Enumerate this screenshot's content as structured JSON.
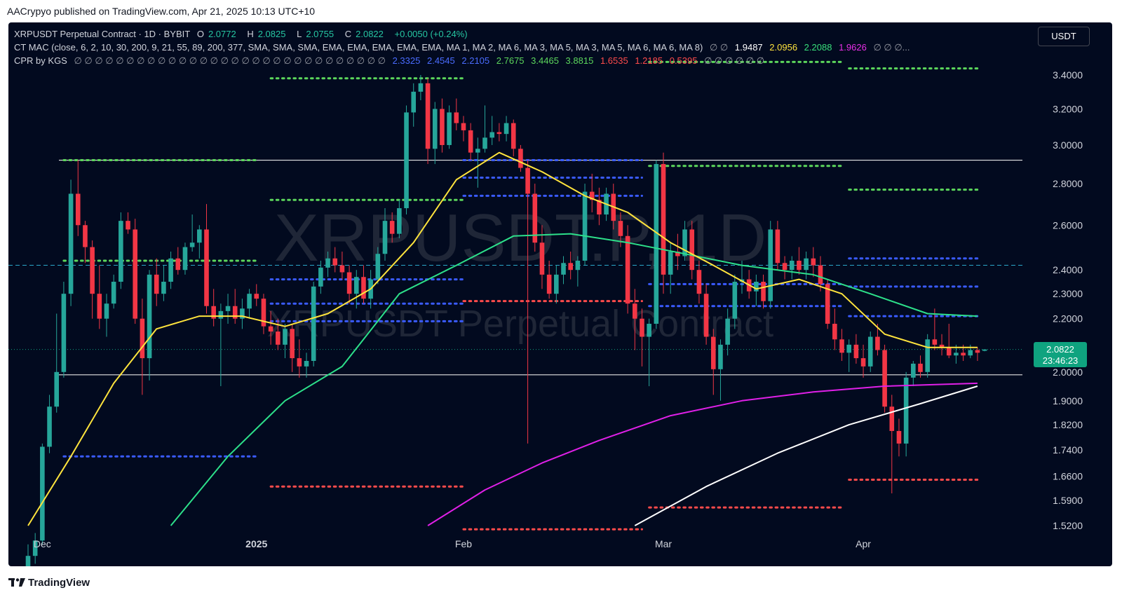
{
  "header": {
    "published": "AACrypyo published on TradingView.com, Apr 21, 2025 10:13 UTC+10"
  },
  "legend1": {
    "symbol": "XRPUSDT Perpetual Contract · 1D · BYBIT",
    "o_label": "O",
    "o": "2.0772",
    "h_label": "H",
    "h": "2.0825",
    "l_label": "L",
    "l": "2.0755",
    "c_label": "C",
    "c": "2.0822",
    "change": "+0.0050 (+0.24%)"
  },
  "legend2": {
    "text": "CT MAC (close, 6, 2, 10, 30, 200, 9, 21, 55, 89, 200, 377, SMA, SMA, SMA, EMA, EMA, EMA, EMA, EMA, MA 1, MA 2, MA 6, MA 3, MA 5, MA 3, MA 5, MA 6, MA 6, MA 8)",
    "placeholders_a": "∅ ∅",
    "v1": "1.9487",
    "v2": "2.0956",
    "v3": "2.2088",
    "v4": "1.9626",
    "placeholders_b": "∅ ∅ ∅..."
  },
  "legend3": {
    "name": "CPR by KGS",
    "placeholders_a": "∅ ∅ ∅ ∅ ∅ ∅ ∅ ∅ ∅ ∅ ∅ ∅ ∅ ∅ ∅ ∅ ∅ ∅ ∅ ∅ ∅ ∅ ∅ ∅ ∅ ∅ ∅ ∅ ∅ ∅",
    "v1": "2.3325",
    "v2": "2.4545",
    "v3": "2.2105",
    "v4": "2.7675",
    "v5": "3.4465",
    "v6": "3.8815",
    "v7": "1.6535",
    "v8": "1.2185",
    "v9": "0.5395",
    "placeholders_b": "∅ ∅ ∅ ∅ ∅ ∅"
  },
  "currency_button": "USDT",
  "price_badge": {
    "price": "2.0822",
    "countdown": "23:46:23"
  },
  "watermark": {
    "line1": "XRPUSDT.P, 1D",
    "line2": "XRPUSDT Perpetual Contract"
  },
  "brand": {
    "name": "TradingView"
  },
  "colors": {
    "up": "#26a69a",
    "down": "#f23645",
    "ema_yellow": "#ffe43d",
    "ema_green": "#2de08a",
    "ma_magenta": "#e020e8",
    "ma_white": "#ffffff",
    "cpr_blue": "#3a5bff",
    "cpr_green": "#5cd65c",
    "cpr_red": "#ff4b4b",
    "background": "#020a1f"
  },
  "chart_data": {
    "type": "candlestick",
    "timeframe": "1D",
    "y_scale": "log",
    "y_ticks": [
      "3.4000",
      "3.2000",
      "3.0000",
      "2.8000",
      "2.6000",
      "2.4000",
      "2.3000",
      "2.2000",
      "2.0000",
      "1.9000",
      "1.8200",
      "1.7400",
      "1.6600",
      "1.5900",
      "1.5200"
    ],
    "x_ticks": [
      "Dec",
      "2025",
      "Feb",
      "Mar",
      "Apr"
    ],
    "last_price": 2.0822,
    "horizontal_lines": [
      2.92,
      1.99
    ],
    "dashed_line": 2.42,
    "candles": [
      [
        1.4,
        1.47,
        1.38,
        1.44
      ],
      [
        1.44,
        1.5,
        1.42,
        1.48
      ],
      [
        1.48,
        1.76,
        1.47,
        1.75
      ],
      [
        1.75,
        1.92,
        1.73,
        1.88
      ],
      [
        1.88,
        2.22,
        1.86,
        2.0
      ],
      [
        2.0,
        2.35,
        1.98,
        2.3
      ],
      [
        2.3,
        2.82,
        2.25,
        2.75
      ],
      [
        2.75,
        2.92,
        2.55,
        2.6
      ],
      [
        2.6,
        2.62,
        2.43,
        2.5
      ],
      [
        2.5,
        2.53,
        2.2,
        2.3
      ],
      [
        2.3,
        2.42,
        2.16,
        2.2
      ],
      [
        2.2,
        2.3,
        2.13,
        2.26
      ],
      [
        2.26,
        2.38,
        2.24,
        2.35
      ],
      [
        2.35,
        2.66,
        2.32,
        2.62
      ],
      [
        2.62,
        2.66,
        2.56,
        2.58
      ],
      [
        2.58,
        2.63,
        2.18,
        2.2
      ],
      [
        2.2,
        2.28,
        1.92,
        2.05
      ],
      [
        2.05,
        2.4,
        1.97,
        2.38
      ],
      [
        2.38,
        2.45,
        2.25,
        2.3
      ],
      [
        2.3,
        2.42,
        2.27,
        2.35
      ],
      [
        2.35,
        2.48,
        2.32,
        2.45
      ],
      [
        2.45,
        2.5,
        2.38,
        2.4
      ],
      [
        2.4,
        2.52,
        2.38,
        2.5
      ],
      [
        2.5,
        2.65,
        2.48,
        2.52
      ],
      [
        2.52,
        2.6,
        2.45,
        2.58
      ],
      [
        2.58,
        2.7,
        2.22,
        2.25
      ],
      [
        2.25,
        2.32,
        2.17,
        2.2
      ],
      [
        2.2,
        2.26,
        1.95,
        2.23
      ],
      [
        2.23,
        2.3,
        2.18,
        2.25
      ],
      [
        2.25,
        2.32,
        2.18,
        2.2
      ],
      [
        2.2,
        2.28,
        2.16,
        2.24
      ],
      [
        2.24,
        2.32,
        2.2,
        2.3
      ],
      [
        2.3,
        2.34,
        2.25,
        2.28
      ],
      [
        2.28,
        2.3,
        2.14,
        2.17
      ],
      [
        2.17,
        2.23,
        2.1,
        2.15
      ],
      [
        2.15,
        2.2,
        2.08,
        2.1
      ],
      [
        2.1,
        2.18,
        2.05,
        2.16
      ],
      [
        2.16,
        2.18,
        2.0,
        2.05
      ],
      [
        2.05,
        2.12,
        1.98,
        2.02
      ],
      [
        2.02,
        2.07,
        1.98,
        2.04
      ],
      [
        2.04,
        2.35,
        2.02,
        2.33
      ],
      [
        2.33,
        2.44,
        2.3,
        2.41
      ],
      [
        2.41,
        2.48,
        2.37,
        2.45
      ],
      [
        2.45,
        2.5,
        2.39,
        2.42
      ],
      [
        2.42,
        2.48,
        2.36,
        2.39
      ],
      [
        2.39,
        2.42,
        2.26,
        2.3
      ],
      [
        2.3,
        2.4,
        2.24,
        2.37
      ],
      [
        2.37,
        2.42,
        2.26,
        2.28
      ],
      [
        2.28,
        2.4,
        2.24,
        2.36
      ],
      [
        2.36,
        2.5,
        2.34,
        2.47
      ],
      [
        2.47,
        2.68,
        2.44,
        2.62
      ],
      [
        2.62,
        2.66,
        2.52,
        2.56
      ],
      [
        2.56,
        2.72,
        2.54,
        2.68
      ],
      [
        2.68,
        3.22,
        2.65,
        3.18
      ],
      [
        3.18,
        3.35,
        3.1,
        3.3
      ],
      [
        3.3,
        3.4,
        3.25,
        3.35
      ],
      [
        3.35,
        3.38,
        2.9,
        2.98
      ],
      [
        2.98,
        3.24,
        2.9,
        3.2
      ],
      [
        3.2,
        3.26,
        2.96,
        3.0
      ],
      [
        3.0,
        3.22,
        2.98,
        3.18
      ],
      [
        3.18,
        3.26,
        3.08,
        3.12
      ],
      [
        3.12,
        3.16,
        3.02,
        3.08
      ],
      [
        3.08,
        3.12,
        2.92,
        2.96
      ],
      [
        2.96,
        3.04,
        2.78,
        2.98
      ],
      [
        2.98,
        3.22,
        2.96,
        3.04
      ],
      [
        3.04,
        3.16,
        3.0,
        3.07
      ],
      [
        3.07,
        3.12,
        3.02,
        3.06
      ],
      [
        3.06,
        3.16,
        3.02,
        3.12
      ],
      [
        3.12,
        3.14,
        2.94,
        2.98
      ],
      [
        2.98,
        3.0,
        2.86,
        2.88
      ],
      [
        2.88,
        2.92,
        1.76,
        2.75
      ],
      [
        2.75,
        2.8,
        2.48,
        2.52
      ],
      [
        2.52,
        2.6,
        2.32,
        2.38
      ],
      [
        2.38,
        2.44,
        2.28,
        2.3
      ],
      [
        2.3,
        2.42,
        2.26,
        2.38
      ],
      [
        2.38,
        2.46,
        2.34,
        2.43
      ],
      [
        2.43,
        2.48,
        2.36,
        2.4
      ],
      [
        2.4,
        2.46,
        2.33,
        2.44
      ],
      [
        2.44,
        2.8,
        2.42,
        2.76
      ],
      [
        2.76,
        2.85,
        2.66,
        2.72
      ],
      [
        2.72,
        2.78,
        2.6,
        2.65
      ],
      [
        2.65,
        2.78,
        2.62,
        2.75
      ],
      [
        2.75,
        2.8,
        2.58,
        2.62
      ],
      [
        2.62,
        2.66,
        2.5,
        2.55
      ],
      [
        2.55,
        2.6,
        2.22,
        2.26
      ],
      [
        2.26,
        2.32,
        2.08,
        2.2
      ],
      [
        2.2,
        2.24,
        2.02,
        2.13
      ],
      [
        2.13,
        2.2,
        1.95,
        2.18
      ],
      [
        2.18,
        2.92,
        2.16,
        2.9
      ],
      [
        2.9,
        2.96,
        2.3,
        2.38
      ],
      [
        2.38,
        2.52,
        2.3,
        2.48
      ],
      [
        2.48,
        2.56,
        2.4,
        2.46
      ],
      [
        2.46,
        2.62,
        2.44,
        2.58
      ],
      [
        2.58,
        2.62,
        2.36,
        2.4
      ],
      [
        2.4,
        2.44,
        2.26,
        2.3
      ],
      [
        2.3,
        2.34,
        2.1,
        2.13
      ],
      [
        2.13,
        2.16,
        1.92,
        2.01
      ],
      [
        2.01,
        2.12,
        1.9,
        2.1
      ],
      [
        2.1,
        2.24,
        2.06,
        2.2
      ],
      [
        2.2,
        2.38,
        2.16,
        2.35
      ],
      [
        2.35,
        2.44,
        2.3,
        2.36
      ],
      [
        2.36,
        2.4,
        2.28,
        2.31
      ],
      [
        2.31,
        2.38,
        2.25,
        2.35
      ],
      [
        2.35,
        2.38,
        2.24,
        2.27
      ],
      [
        2.27,
        2.62,
        2.24,
        2.58
      ],
      [
        2.58,
        2.62,
        2.4,
        2.43
      ],
      [
        2.43,
        2.46,
        2.36,
        2.4
      ],
      [
        2.4,
        2.46,
        2.36,
        2.44
      ],
      [
        2.44,
        2.5,
        2.38,
        2.4
      ],
      [
        2.4,
        2.48,
        2.36,
        2.45
      ],
      [
        2.45,
        2.5,
        2.37,
        2.42
      ],
      [
        2.42,
        2.46,
        2.31,
        2.34
      ],
      [
        2.34,
        2.36,
        2.16,
        2.18
      ],
      [
        2.18,
        2.24,
        2.08,
        2.12
      ],
      [
        2.12,
        2.16,
        2.04,
        2.07
      ],
      [
        2.07,
        2.12,
        2.0,
        2.1
      ],
      [
        2.1,
        2.14,
        2.03,
        2.05
      ],
      [
        2.05,
        2.1,
        1.98,
        2.02
      ],
      [
        2.02,
        2.15,
        2.0,
        2.13
      ],
      [
        2.13,
        2.18,
        2.06,
        2.08
      ],
      [
        2.08,
        2.1,
        1.86,
        1.88
      ],
      [
        1.88,
        1.92,
        1.61,
        1.8
      ],
      [
        1.8,
        1.84,
        1.72,
        1.76
      ],
      [
        1.76,
        2.0,
        1.72,
        1.98
      ],
      [
        1.98,
        2.04,
        1.95,
        2.03
      ],
      [
        2.03,
        2.06,
        1.98,
        2.0
      ],
      [
        2.0,
        2.14,
        1.98,
        2.12
      ],
      [
        2.12,
        2.24,
        2.08,
        2.1
      ],
      [
        2.1,
        2.14,
        2.06,
        2.09
      ],
      [
        2.09,
        2.18,
        2.05,
        2.06
      ],
      [
        2.06,
        2.1,
        2.03,
        2.07
      ],
      [
        2.07,
        2.1,
        2.04,
        2.06
      ],
      [
        2.06,
        2.1,
        2.05,
        2.08
      ],
      [
        2.08,
        2.09,
        2.04,
        2.07
      ],
      [
        2.0772,
        2.0825,
        2.0755,
        2.0822
      ]
    ],
    "ema_yellow": [
      [
        0,
        1.52
      ],
      [
        6,
        1.72
      ],
      [
        12,
        1.96
      ],
      [
        18,
        2.16
      ],
      [
        24,
        2.21
      ],
      [
        30,
        2.21
      ],
      [
        36,
        2.17
      ],
      [
        42,
        2.22
      ],
      [
        48,
        2.32
      ],
      [
        54,
        2.52
      ],
      [
        60,
        2.82
      ],
      [
        66,
        2.96
      ],
      [
        72,
        2.86
      ],
      [
        78,
        2.74
      ],
      [
        84,
        2.66
      ],
      [
        90,
        2.52
      ],
      [
        96,
        2.42
      ],
      [
        102,
        2.32
      ],
      [
        108,
        2.36
      ],
      [
        114,
        2.3
      ],
      [
        120,
        2.14
      ],
      [
        126,
        2.09
      ],
      [
        133,
        2.09
      ]
    ],
    "ema_green": [
      [
        20,
        1.52
      ],
      [
        28,
        1.72
      ],
      [
        36,
        1.9
      ],
      [
        44,
        2.02
      ],
      [
        52,
        2.3
      ],
      [
        60,
        2.42
      ],
      [
        68,
        2.55
      ],
      [
        76,
        2.56
      ],
      [
        84,
        2.52
      ],
      [
        92,
        2.47
      ],
      [
        100,
        2.42
      ],
      [
        110,
        2.38
      ],
      [
        118,
        2.3
      ],
      [
        126,
        2.22
      ],
      [
        133,
        2.21
      ]
    ],
    "ma_magenta": [
      [
        56,
        1.52
      ],
      [
        64,
        1.62
      ],
      [
        72,
        1.7
      ],
      [
        80,
        1.77
      ],
      [
        90,
        1.85
      ],
      [
        100,
        1.9
      ],
      [
        110,
        1.93
      ],
      [
        120,
        1.95
      ],
      [
        133,
        1.96
      ]
    ],
    "ma_white": [
      [
        85,
        1.52
      ],
      [
        95,
        1.63
      ],
      [
        105,
        1.73
      ],
      [
        115,
        1.82
      ],
      [
        125,
        1.89
      ],
      [
        133,
        1.95
      ]
    ],
    "cpr_levels": [
      {
        "color": "green",
        "from": 5,
        "to": 32,
        "value": 2.92
      },
      {
        "color": "green",
        "from": 5,
        "to": 32,
        "value": 2.44
      },
      {
        "color": "blue",
        "from": 5,
        "to": 32,
        "value": 1.72
      },
      {
        "color": "green",
        "from": 34,
        "to": 61,
        "value": 3.38
      },
      {
        "color": "green",
        "from": 34,
        "to": 61,
        "value": 2.72
      },
      {
        "color": "blue",
        "from": 34,
        "to": 61,
        "value": 2.36
      },
      {
        "color": "blue",
        "from": 34,
        "to": 61,
        "value": 2.26
      },
      {
        "color": "blue",
        "from": 34,
        "to": 61,
        "value": 2.19
      },
      {
        "color": "red",
        "from": 34,
        "to": 61,
        "value": 1.63
      },
      {
        "color": "blue",
        "from": 61,
        "to": 86,
        "value": 2.92
      },
      {
        "color": "blue",
        "from": 61,
        "to": 86,
        "value": 2.83
      },
      {
        "color": "blue",
        "from": 61,
        "to": 86,
        "value": 2.74
      },
      {
        "color": "red",
        "from": 61,
        "to": 86,
        "value": 2.27
      },
      {
        "color": "red",
        "from": 61,
        "to": 86,
        "value": 1.51
      },
      {
        "color": "green",
        "from": 87,
        "to": 114,
        "value": 3.48
      },
      {
        "color": "green",
        "from": 87,
        "to": 114,
        "value": 2.89
      },
      {
        "color": "blue",
        "from": 87,
        "to": 114,
        "value": 2.34
      },
      {
        "color": "blue",
        "from": 87,
        "to": 114,
        "value": 2.25
      },
      {
        "color": "red",
        "from": 87,
        "to": 114,
        "value": 1.57
      },
      {
        "color": "green",
        "from": 115,
        "to": 133,
        "value": 3.44
      },
      {
        "color": "green",
        "from": 115,
        "to": 133,
        "value": 2.77
      },
      {
        "color": "blue",
        "from": 115,
        "to": 133,
        "value": 2.45
      },
      {
        "color": "blue",
        "from": 115,
        "to": 133,
        "value": 2.33
      },
      {
        "color": "blue",
        "from": 115,
        "to": 133,
        "value": 2.21
      },
      {
        "color": "red",
        "from": 115,
        "to": 133,
        "value": 1.65
      }
    ]
  }
}
